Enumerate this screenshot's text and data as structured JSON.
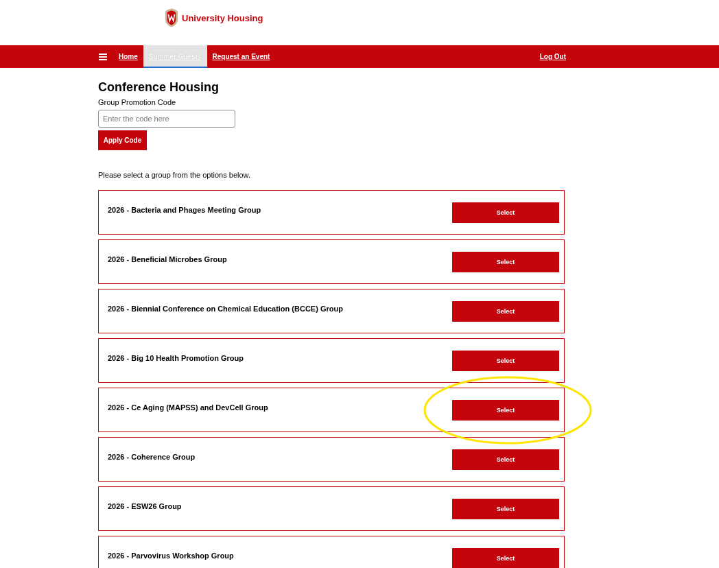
{
  "header": {
    "logo_text": "University Housing"
  },
  "nav": {
    "items": [
      {
        "label": "Home",
        "selected": false
      },
      {
        "label": "Summer Guests",
        "selected": true
      },
      {
        "label": "Request an Event",
        "selected": false
      }
    ],
    "logout": "Log Out"
  },
  "page": {
    "title": "Conference Housing",
    "promo_label": "Group Promotion Code",
    "promo_field": {
      "placeholder": "Enter the code here"
    },
    "apply_button": "Apply Code",
    "intro": "Please select a group from the options below."
  },
  "groups": [
    {
      "name": "2026 - Bacteria and Phages Meeting Group",
      "button": "Select",
      "highlighted": false
    },
    {
      "name": "2026 - Beneficial Microbes Group",
      "button": "Select",
      "highlighted": false
    },
    {
      "name": "2026 - Biennial Conference on Chemical Education (BCCE) Group",
      "button": "Select",
      "highlighted": false
    },
    {
      "name": "2026 - Big 10 Health Promotion Group",
      "button": "Select",
      "highlighted": false
    },
    {
      "name": "2026 - Ce Aging (MAPSS) and DevCell Group",
      "button": "Select",
      "highlighted": true
    },
    {
      "name": "2026 - Coherence Group",
      "button": "Select",
      "highlighted": false
    },
    {
      "name": "2026 - ESW26 Group",
      "button": "Select",
      "highlighted": false
    },
    {
      "name": "2026 - Parvovirus Workshop Group",
      "button": "Select",
      "highlighted": false
    }
  ]
}
